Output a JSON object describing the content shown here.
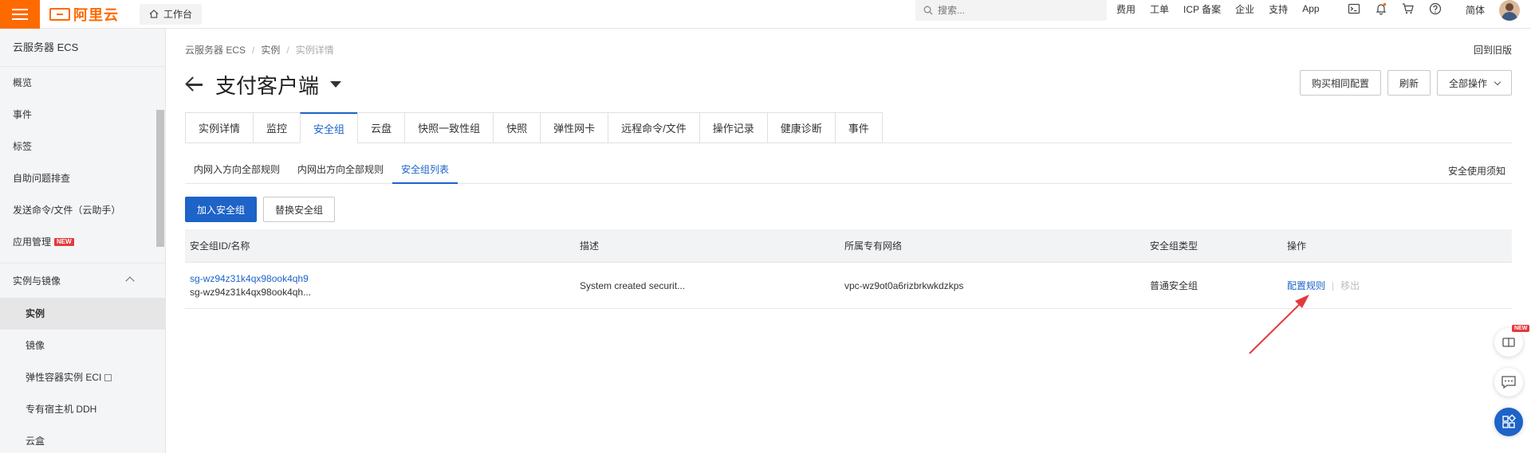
{
  "topbar": {
    "logo_text": "阿里云",
    "workbench_label": "工作台",
    "search_placeholder": "搜索...",
    "links": [
      "费用",
      "工单",
      "ICP 备案",
      "企业",
      "支持",
      "App"
    ],
    "icons": [
      "terminal-icon",
      "bell-icon",
      "cart-icon",
      "help-icon"
    ],
    "language": "简体",
    "brand_color": "#ff6a00"
  },
  "sidebar": {
    "title": "云服务器 ECS",
    "items": [
      {
        "label": "概览"
      },
      {
        "label": "事件"
      },
      {
        "label": "标签"
      },
      {
        "label": "自助问题排查"
      },
      {
        "label": "发送命令/文件（云助手）"
      },
      {
        "label": "应用管理",
        "badge": "NEW"
      }
    ],
    "group": {
      "label": "实例与镜像",
      "items": [
        {
          "label": "实例",
          "active": true
        },
        {
          "label": "镜像"
        },
        {
          "label": "弹性容器实例 ECI"
        },
        {
          "label": "专有宿主机 DDH"
        },
        {
          "label": "云盒"
        }
      ]
    }
  },
  "breadcrumb": [
    "云服务器 ECS",
    "实例",
    "实例详情"
  ],
  "old_version_link": "回到旧版",
  "page_title": "支付客户端",
  "header_buttons": {
    "buy_same": "购买相同配置",
    "refresh": "刷新",
    "all_ops": "全部操作"
  },
  "tabs": [
    "实例详情",
    "监控",
    "安全组",
    "云盘",
    "快照一致性组",
    "快照",
    "弹性网卡",
    "远程命令/文件",
    "操作记录",
    "健康诊断",
    "事件"
  ],
  "active_tab": "安全组",
  "subtabs": [
    "内网入方向全部规则",
    "内网出方向全部规则",
    "安全组列表"
  ],
  "active_subtab": "安全组列表",
  "notice_link": "安全使用须知",
  "actions": {
    "add": "加入安全组",
    "replace": "替换安全组"
  },
  "table": {
    "columns": [
      "安全组ID/名称",
      "描述",
      "所属专有网络",
      "安全组类型",
      "操作"
    ],
    "rows": [
      {
        "id": "sg-wz94z31k4qx98ook4qh9",
        "name": "sg-wz94z31k4qx98ook4qh...",
        "description": "System created securit...",
        "vpc": "vpc-wz9ot0a6rizbrkwkdzkps",
        "type": "普通安全组",
        "op_config": "配置规则",
        "op_separator": "|",
        "op_remove": "移出"
      }
    ]
  },
  "float_badge": "NEW",
  "accent_color": "#1d63c8",
  "annotation_color": "#e4393c"
}
